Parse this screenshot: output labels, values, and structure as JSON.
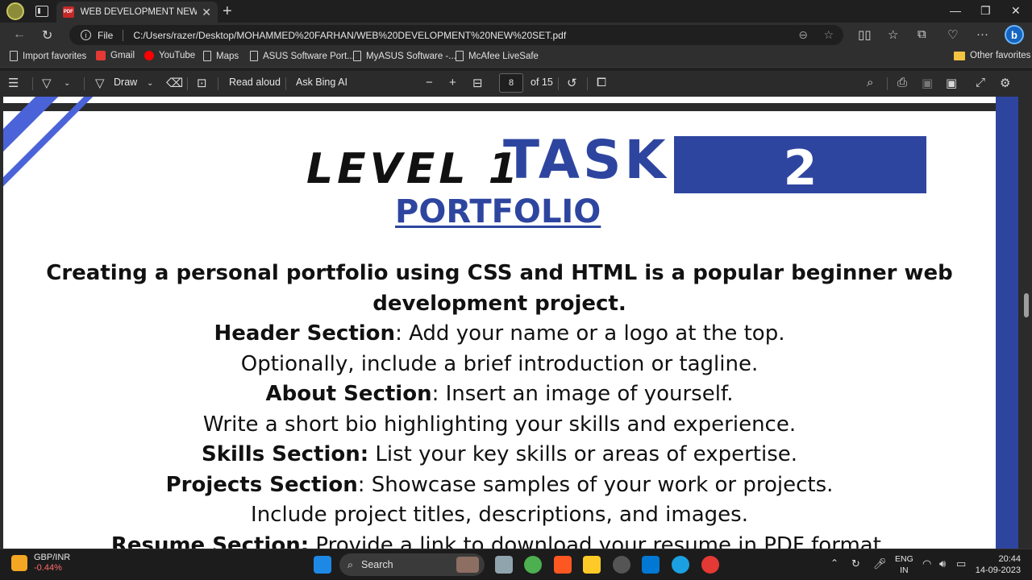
{
  "browser": {
    "tab_title": "WEB DEVELOPMENT NEW SET.pdf",
    "tab_icon_text": "PDF",
    "address_prefix": "File",
    "url": "C:/Users/razer/Desktop/MOHAMMED%20FARHAN/WEB%20DEVELOPMENT%20NEW%20SET.pdf"
  },
  "favorites": {
    "items": [
      "Import favorites",
      "Gmail",
      "YouTube",
      "Maps",
      "ASUS Software Port...",
      "MyASUS Software -...",
      "McAfee LiveSafe"
    ],
    "other": "Other favorites"
  },
  "pdf_toolbar": {
    "draw": "Draw",
    "read_aloud": "Read aloud",
    "ask_bing": "Ask Bing AI",
    "page_current": "8",
    "page_total": "of 15"
  },
  "document": {
    "level": "LEVEL 1",
    "task": "TASK",
    "task_number": "2",
    "heading": "PORTFOLIO",
    "intro": "Creating a personal portfolio using CSS and HTML is a popular beginner web development project.",
    "lines": [
      {
        "bold": "Header Section",
        "text": ":     Add your name or a logo at the top."
      },
      {
        "bold": "",
        "text": "Optionally, include a brief introduction or tagline."
      },
      {
        "bold": "About Section",
        "text": ": Insert an image of yourself."
      },
      {
        "bold": "",
        "text": "Write a short bio highlighting your skills and experience."
      },
      {
        "bold": "Skills Section:",
        "text": " List your key skills or areas of expertise."
      },
      {
        "bold": "Projects Section",
        "text": ": Showcase samples of your work or projects."
      },
      {
        "bold": "",
        "text": "Include project titles, descriptions, and images."
      },
      {
        "bold": "Resume Section:",
        "text": " Provide a link to download your resume in PDF format."
      }
    ]
  },
  "taskbar": {
    "ticker_symbol": "GBP/INR",
    "ticker_change": "-0.44%",
    "search": "Search",
    "lang_top": "ENG",
    "lang_bottom": "IN",
    "time": "20:44",
    "date": "14-09-2023"
  },
  "colors": {
    "accent_blue": "#2e45a0",
    "stripe_blue": "#4a63d8",
    "negative": "#ff6b6b"
  }
}
